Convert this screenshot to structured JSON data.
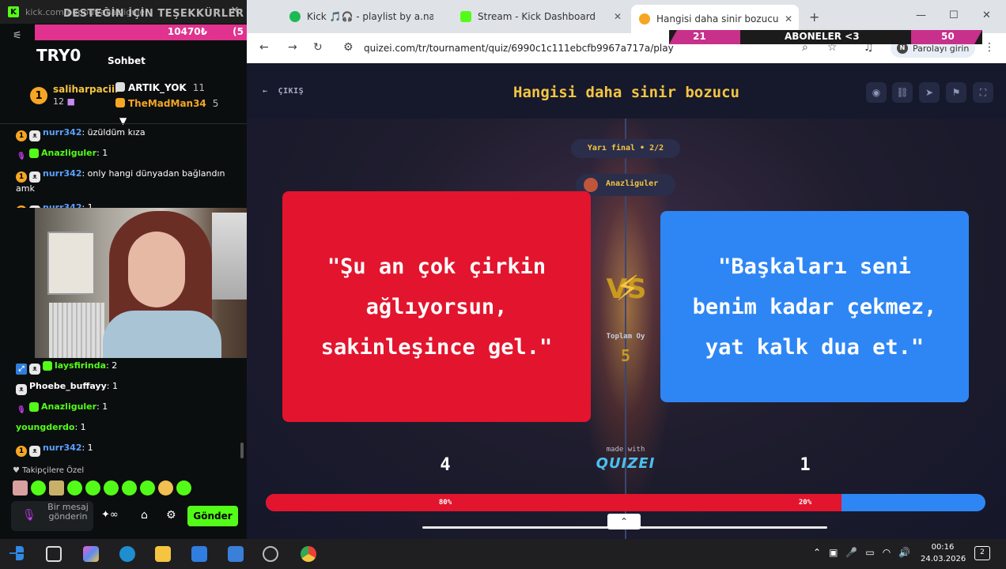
{
  "chat": {
    "url": "kick.com/popout/anazliguler",
    "donation_overlay": "DESTEĞİN İÇİN TEŞEKKÜRLER <3",
    "goal_text": "10470₺",
    "goal_text_2": "(5",
    "try_text": "TRY0",
    "title": "Sohbet",
    "top_gifter": {
      "rank": "1",
      "name": "saliharpaciii",
      "count": "12"
    },
    "gifters": [
      {
        "name": "ARTIK_YOK",
        "count": "11",
        "color": "#ffffff"
      },
      {
        "name": "TheMadMan34",
        "count": "5",
        "color": "#f5a623"
      }
    ],
    "messages": [
      {
        "user": "nurr342",
        "text": ": üzüldüm kıza",
        "color": "#5aa0ff"
      },
      {
        "user": "Anazliguler",
        "text": ": 1",
        "color": "#53fc18"
      },
      {
        "user": "nurr342",
        "text": ": only hangi dünyadan bağlandın amk",
        "color": "#5aa0ff"
      },
      {
        "user": "nurr342",
        "text": ": 1",
        "color": "#5aa0ff"
      },
      {
        "user": "laysfirinda",
        "text": ": 2",
        "color": "#53fc18"
      },
      {
        "user": "Phoebe_buffayy",
        "text": ": 1",
        "color": "#ffffff"
      },
      {
        "user": "Anazliguler",
        "text": ": 1",
        "color": "#53fc18"
      },
      {
        "user": "youngderdo",
        "text": ": 1",
        "color": "#53fc18"
      },
      {
        "user": "nurr342",
        "text": ": 1",
        "color": "#5aa0ff"
      }
    ],
    "followers_only": "Takipçilere Özel",
    "input_placeholder": "Bir mesaj gönderin",
    "send_label": "Gönder"
  },
  "browser": {
    "tabs": [
      {
        "title": "Kick 🎵🎧 - playlist by a.nazlig",
        "favicon_color": "#1db954"
      },
      {
        "title": "Stream - Kick Dashboard",
        "favicon_color": "#53fc18"
      },
      {
        "title": "Hangisi daha sinir bozucu - Tier",
        "favicon_color": "#f5a623"
      }
    ],
    "url": "quizei.com/tr/tournament/quiz/6990c1c111ebcfb9967a717a/play",
    "password_chip": "Parolayı girin",
    "overlay": {
      "left_num": "21",
      "label": "ABONELER <3",
      "right_num": "50"
    }
  },
  "quiz": {
    "exit_label": "ÇIKIŞ",
    "title": "Hangisi daha sinir bozucu",
    "round": "Yarı final • 2/2",
    "user": "Anazliguler",
    "left_option": "\"Şu an çok çirkin ağlıyorsun, sakinleşince gel.\"",
    "right_option": "\"Başkaları seni benim kadar çekmez, yat kalk dua et.\"",
    "vs_label": "VS",
    "total_label": "Toplam Oy",
    "total_value": "5",
    "left_votes": "4",
    "right_votes": "1",
    "left_pct_label": "80%",
    "right_pct_label": "20%",
    "left_pct": 80,
    "made_with": "made with",
    "logo": "QUIZEI",
    "colors": {
      "left": "#e3142d",
      "right": "#2e86f5",
      "accent": "#f5c542"
    }
  },
  "taskbar": {
    "time": "00:16",
    "date": "24.03.2026",
    "notif_count": "2"
  }
}
